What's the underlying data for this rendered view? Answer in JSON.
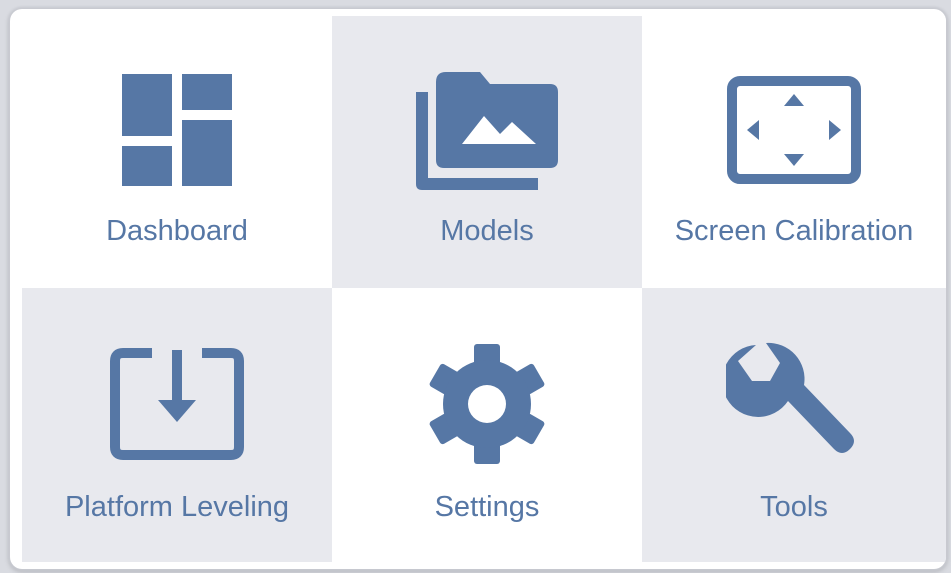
{
  "accent_color": "#5677a5",
  "tiles": [
    {
      "label": "Dashboard",
      "icon": "dashboard-icon"
    },
    {
      "label": "Models",
      "icon": "folder-images-icon"
    },
    {
      "label": "Screen Calibration",
      "icon": "screen-expand-icon"
    },
    {
      "label": "Platform Leveling",
      "icon": "download-tray-icon"
    },
    {
      "label": "Settings",
      "icon": "gear-icon"
    },
    {
      "label": "Tools",
      "icon": "wrench-icon"
    }
  ]
}
